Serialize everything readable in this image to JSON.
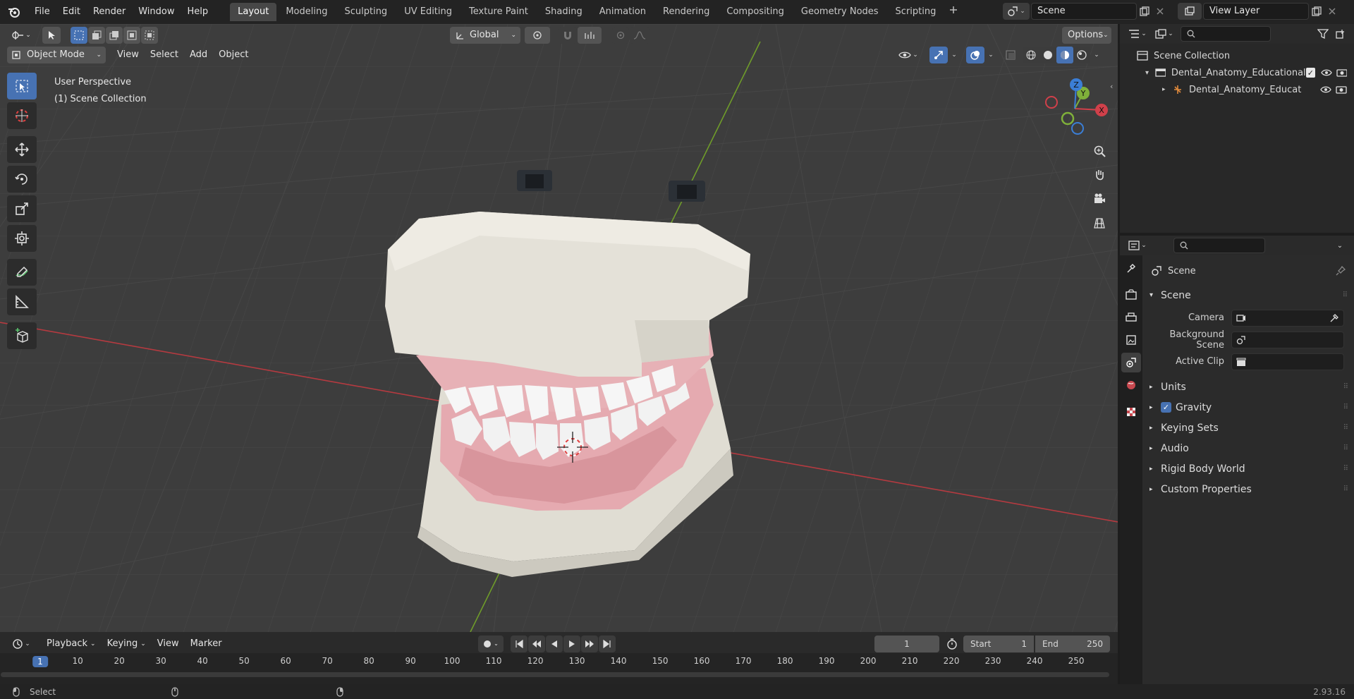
{
  "menu": [
    "File",
    "Edit",
    "Render",
    "Window",
    "Help"
  ],
  "workspaces": [
    "Layout",
    "Modeling",
    "Sculpting",
    "UV Editing",
    "Texture Paint",
    "Shading",
    "Animation",
    "Rendering",
    "Compositing",
    "Geometry Nodes",
    "Scripting"
  ],
  "active_workspace": "Layout",
  "scene_field": "Scene",
  "view_layer_field": "View Layer",
  "viewport": {
    "mode": "Object Mode",
    "menus": [
      "View",
      "Select",
      "Add",
      "Object"
    ],
    "orientation": "Global",
    "options_label": "Options",
    "overlay_line1": "User Perspective",
    "overlay_line2": "(1) Scene Collection",
    "gizmo_axes": {
      "x": "X",
      "y": "Y",
      "z": "Z"
    }
  },
  "outliner": {
    "root": "Scene Collection",
    "items": [
      {
        "label": "Dental_Anatomy_Educational"
      },
      {
        "label": "Dental_Anatomy_Educat"
      }
    ]
  },
  "properties": {
    "context_label": "Scene",
    "panel_title": "Scene",
    "fields": [
      {
        "label": "Camera"
      },
      {
        "label": "Background Scene"
      },
      {
        "label": "Active Clip"
      }
    ],
    "subpanels": [
      "Units",
      "Gravity",
      "Keying Sets",
      "Audio",
      "Rigid Body World",
      "Custom Properties"
    ],
    "gravity_checked": true
  },
  "timeline": {
    "menus": [
      "Playback",
      "Keying",
      "View",
      "Marker"
    ],
    "current_frame": "1",
    "start_label": "Start",
    "start_value": "1",
    "end_label": "End",
    "end_value": "250",
    "ruler_ticks": [
      "1",
      "10",
      "20",
      "30",
      "40",
      "50",
      "60",
      "70",
      "80",
      "90",
      "100",
      "110",
      "120",
      "130",
      "140",
      "150",
      "160",
      "170",
      "180",
      "190",
      "200",
      "210",
      "220",
      "230",
      "240",
      "250"
    ]
  },
  "statusbar": {
    "left_label": "Select",
    "version": "2.93.16"
  },
  "colors": {
    "accent": "#4772b3",
    "viewport_bg": "#3d3d3d",
    "axis_x": "#b53a40",
    "axis_y": "#6f9c2a"
  }
}
